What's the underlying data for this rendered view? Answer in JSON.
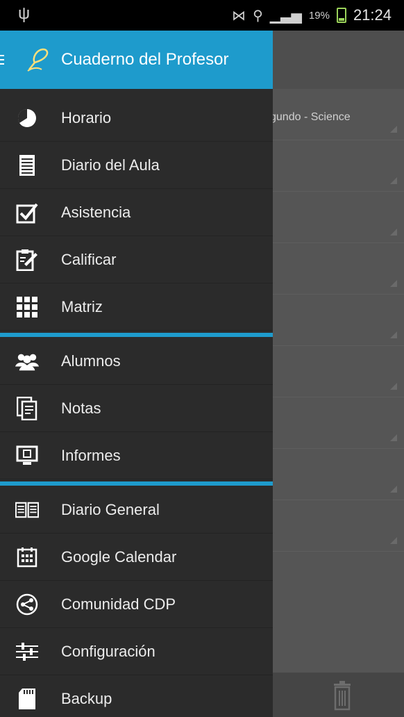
{
  "status_bar": {
    "battery_percent": "19%",
    "time": "21:24"
  },
  "app": {
    "title": "Cuaderno del Profesor"
  },
  "background": {
    "header_text": "gundo - Science"
  },
  "drawer": {
    "group1": [
      {
        "label": "Horario",
        "icon": "clock-icon"
      },
      {
        "label": "Diario del Aula",
        "icon": "document-icon"
      },
      {
        "label": "Asistencia",
        "icon": "checkbox-icon"
      },
      {
        "label": "Calificar",
        "icon": "clipboard-edit-icon"
      },
      {
        "label": "Matriz",
        "icon": "grid-icon"
      }
    ],
    "group2": [
      {
        "label": "Alumnos",
        "icon": "people-icon"
      },
      {
        "label": "Notas",
        "icon": "notes-icon"
      },
      {
        "label": "Informes",
        "icon": "monitor-icon"
      }
    ],
    "group3": [
      {
        "label": "Diario General",
        "icon": "book-icon"
      },
      {
        "label": "Google Calendar",
        "icon": "calendar-icon"
      },
      {
        "label": "Comunidad CDP",
        "icon": "share-circle-icon"
      },
      {
        "label": "Configuración",
        "icon": "sliders-icon"
      },
      {
        "label": "Backup",
        "icon": "sd-card-icon"
      }
    ]
  },
  "colors": {
    "accent": "#1e9bcc",
    "drawer_bg": "#2b2b2b",
    "text": "#ececec"
  }
}
